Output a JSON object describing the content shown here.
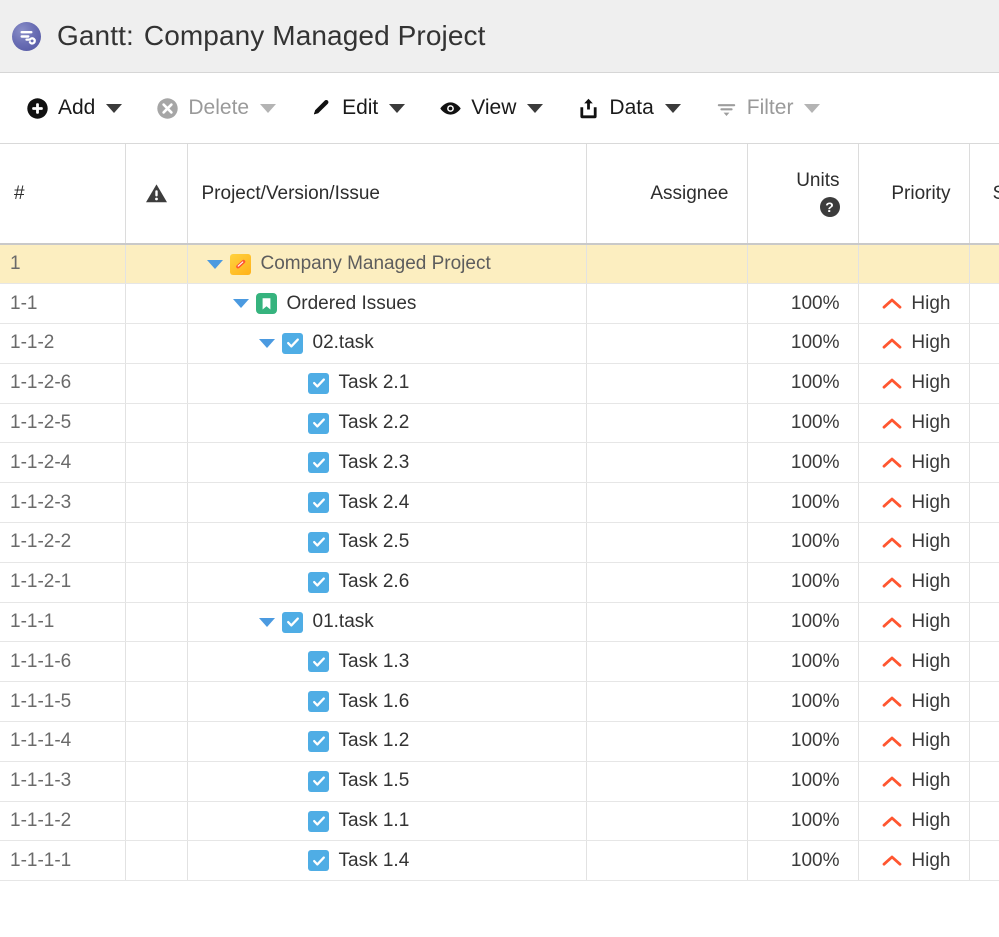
{
  "titlebar": {
    "logo_icon": "gantt-app-logo-icon",
    "prefix": "Gantt:",
    "project_name": "Company Managed Project"
  },
  "toolbar": {
    "items": [
      {
        "label": "Add",
        "icon": "plus-circle-icon",
        "disabled": false
      },
      {
        "label": "Delete",
        "icon": "x-circle-icon",
        "disabled": true
      },
      {
        "label": "Edit",
        "icon": "pencil-icon",
        "disabled": false
      },
      {
        "label": "View",
        "icon": "eye-icon",
        "disabled": false
      },
      {
        "label": "Data",
        "icon": "upload-box-icon",
        "disabled": false
      },
      {
        "label": "Filter",
        "icon": "filter-lines-icon",
        "disabled": true
      }
    ]
  },
  "table": {
    "columns": [
      {
        "key": "num",
        "label": "#"
      },
      {
        "key": "warning",
        "label": "",
        "icon": "warning-triangle-icon"
      },
      {
        "key": "name",
        "label": "Project/Version/Issue"
      },
      {
        "key": "assignee",
        "label": "Assignee"
      },
      {
        "key": "units",
        "label": "Units",
        "help_icon": "question-circle-icon"
      },
      {
        "key": "priority",
        "label": "Priority"
      },
      {
        "key": "status",
        "label": "Status"
      }
    ],
    "rows": [
      {
        "num": "1",
        "name": "Company Managed Project",
        "icon": "project-icon",
        "indent": 0,
        "twisty": "expanded",
        "assignee": "",
        "units": "",
        "priority": "",
        "priority_icon": "",
        "status": "",
        "selected": true
      },
      {
        "num": "1-1",
        "name": "Ordered Issues",
        "icon": "version-icon",
        "indent": 1,
        "twisty": "expanded",
        "assignee": "",
        "units": "100%",
        "priority": "High",
        "priority_icon": "priority-high-icon",
        "status": "",
        "selected": false
      },
      {
        "num": "1-1-2",
        "name": "02.task",
        "icon": "task-icon",
        "indent": 2,
        "twisty": "expanded",
        "assignee": "",
        "units": "100%",
        "priority": "High",
        "priority_icon": "priority-high-icon",
        "status": "",
        "selected": false
      },
      {
        "num": "1-1-2-6",
        "name": "Task 2.1",
        "icon": "task-icon",
        "indent": 3,
        "twisty": "none",
        "assignee": "",
        "units": "100%",
        "priority": "High",
        "priority_icon": "priority-high-icon",
        "status": "",
        "selected": false
      },
      {
        "num": "1-1-2-5",
        "name": "Task 2.2",
        "icon": "task-icon",
        "indent": 3,
        "twisty": "none",
        "assignee": "",
        "units": "100%",
        "priority": "High",
        "priority_icon": "priority-high-icon",
        "status": "",
        "selected": false
      },
      {
        "num": "1-1-2-4",
        "name": "Task 2.3",
        "icon": "task-icon",
        "indent": 3,
        "twisty": "none",
        "assignee": "",
        "units": "100%",
        "priority": "High",
        "priority_icon": "priority-high-icon",
        "status": "",
        "selected": false
      },
      {
        "num": "1-1-2-3",
        "name": "Task 2.4",
        "icon": "task-icon",
        "indent": 3,
        "twisty": "none",
        "assignee": "",
        "units": "100%",
        "priority": "High",
        "priority_icon": "priority-high-icon",
        "status": "",
        "selected": false
      },
      {
        "num": "1-1-2-2",
        "name": "Task 2.5",
        "icon": "task-icon",
        "indent": 3,
        "twisty": "none",
        "assignee": "",
        "units": "100%",
        "priority": "High",
        "priority_icon": "priority-high-icon",
        "status": "",
        "selected": false
      },
      {
        "num": "1-1-2-1",
        "name": "Task 2.6",
        "icon": "task-icon",
        "indent": 3,
        "twisty": "none",
        "assignee": "",
        "units": "100%",
        "priority": "High",
        "priority_icon": "priority-high-icon",
        "status": "",
        "selected": false
      },
      {
        "num": "1-1-1",
        "name": "01.task",
        "icon": "task-icon",
        "indent": 2,
        "twisty": "expanded",
        "assignee": "",
        "units": "100%",
        "priority": "High",
        "priority_icon": "priority-high-icon",
        "status": "",
        "selected": false
      },
      {
        "num": "1-1-1-6",
        "name": "Task 1.3",
        "icon": "task-icon",
        "indent": 3,
        "twisty": "none",
        "assignee": "",
        "units": "100%",
        "priority": "High",
        "priority_icon": "priority-high-icon",
        "status": "",
        "selected": false
      },
      {
        "num": "1-1-1-5",
        "name": "Task 1.6",
        "icon": "task-icon",
        "indent": 3,
        "twisty": "none",
        "assignee": "",
        "units": "100%",
        "priority": "High",
        "priority_icon": "priority-high-icon",
        "status": "",
        "selected": false
      },
      {
        "num": "1-1-1-4",
        "name": "Task 1.2",
        "icon": "task-icon",
        "indent": 3,
        "twisty": "none",
        "assignee": "",
        "units": "100%",
        "priority": "High",
        "priority_icon": "priority-high-icon",
        "status": "",
        "selected": false
      },
      {
        "num": "1-1-1-3",
        "name": "Task 1.5",
        "icon": "task-icon",
        "indent": 3,
        "twisty": "none",
        "assignee": "",
        "units": "100%",
        "priority": "High",
        "priority_icon": "priority-high-icon",
        "status": "",
        "selected": false
      },
      {
        "num": "1-1-1-2",
        "name": "Task 1.1",
        "icon": "task-icon",
        "indent": 3,
        "twisty": "none",
        "assignee": "",
        "units": "100%",
        "priority": "High",
        "priority_icon": "priority-high-icon",
        "status": "",
        "selected": false
      },
      {
        "num": "1-1-1-1",
        "name": "Task 1.4",
        "icon": "task-icon",
        "indent": 3,
        "twisty": "none",
        "assignee": "",
        "units": "100%",
        "priority": "High",
        "priority_icon": "priority-high-icon",
        "status": "",
        "selected": false
      }
    ]
  },
  "colors": {
    "selected_row": "#fceec0",
    "priority_high": "#ff5630",
    "task_blue": "#4fade5",
    "version_green": "#36b37e",
    "twisty_blue": "#4b9ae0",
    "titlebar_bg": "#efefef"
  }
}
